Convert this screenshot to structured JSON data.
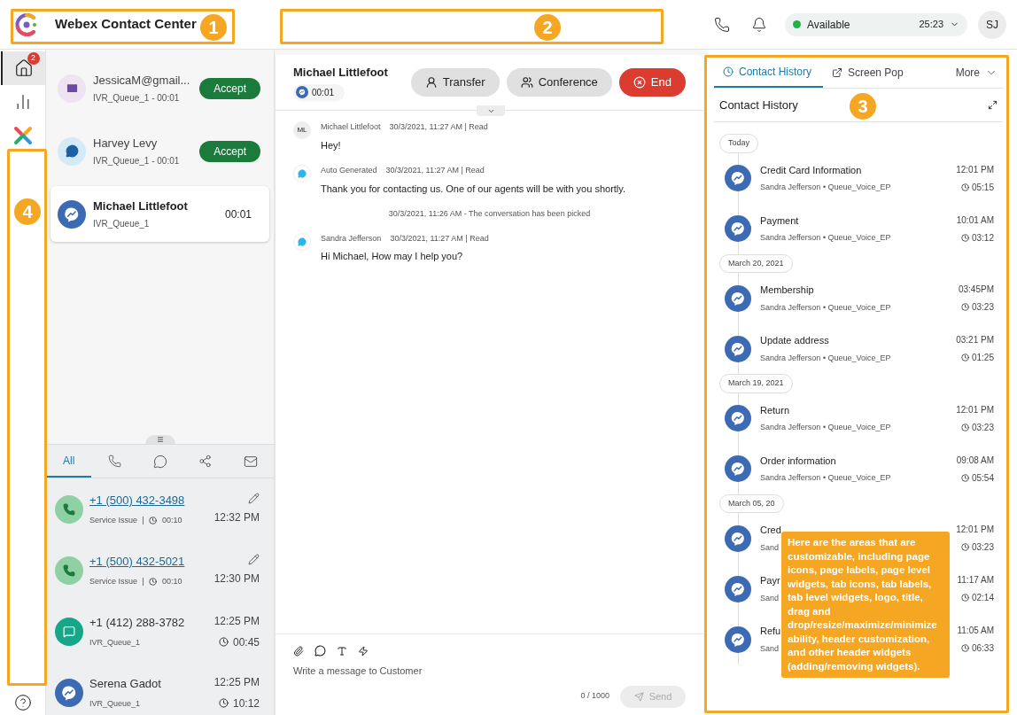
{
  "header": {
    "title": "Webex Contact Center",
    "status": {
      "label": "Available",
      "color": "#22b14c",
      "timer": "25:23"
    },
    "avatar": "SJ"
  },
  "nav": [
    {
      "kind": "home",
      "badge": "2",
      "selected": true
    },
    {
      "kind": "chart",
      "selected": false
    },
    {
      "kind": "apps",
      "selected": false
    }
  ],
  "tasks": [
    {
      "kind": "email",
      "name": "JessicaM@gmail...",
      "sub": "IVR_Queue_1 - 00:01",
      "action": "Accept",
      "selected": false
    },
    {
      "kind": "chat",
      "name": "Harvey Levy",
      "sub": "IVR_Queue_1 - 00:01",
      "action": "Accept",
      "selected": false
    },
    {
      "kind": "messenger",
      "name": "Michael Littlefoot",
      "sub": "IVR_Queue_1",
      "timer": "00:01",
      "selected": true
    }
  ],
  "history_tabs": [
    {
      "kind": "text",
      "label": "All",
      "selected": true
    },
    {
      "kind": "phone",
      "selected": false
    },
    {
      "kind": "chat",
      "selected": false
    },
    {
      "kind": "social",
      "selected": false
    },
    {
      "kind": "email",
      "selected": false
    }
  ],
  "history": [
    {
      "kind": "call",
      "title": "+1 (500) 432-3498",
      "link": true,
      "sub": "Service Issue",
      "duration": "00:10",
      "time": "12:32 PM"
    },
    {
      "kind": "call",
      "title": "+1 (500) 432-5021",
      "link": true,
      "sub": "Service Issue",
      "duration": "00:10",
      "time": "12:30 PM"
    },
    {
      "kind": "sms",
      "title": "+1 (412) 288-3782",
      "link": false,
      "sub": "IVR_Queue_1",
      "duration": "00:45",
      "time": "12:25 PM"
    },
    {
      "kind": "messenger",
      "title": "Serena Gadot",
      "link": false,
      "sub": "IVR_Queue_1",
      "duration": "10:12",
      "time": "12:25 PM"
    }
  ],
  "conversation": {
    "name": "Michael Littlefoot",
    "timer": "00:01",
    "buttons": [
      {
        "kind": "transfer",
        "label": "Transfer"
      },
      {
        "kind": "conference",
        "label": "Conference"
      },
      {
        "kind": "end",
        "label": "End"
      }
    ],
    "messages": [
      {
        "kind": "initials",
        "avatar": "ML",
        "sender": "Michael Littlefoot",
        "meta": "30/3/2021, 11:27 AM | Read",
        "text": "Hey!"
      },
      {
        "kind": "bot",
        "sender": "Auto Generated",
        "meta": "30/3/2021, 11:27 AM | Read",
        "text": "Thank you for contacting us. One of our agents will be with you shortly."
      },
      {
        "kind": "system",
        "text": "30/3/2021, 11:26 AM - The conversation has been picked"
      },
      {
        "kind": "bot",
        "sender": "Sandra Jefferson",
        "meta": "30/3/2021, 11:27 AM | Read",
        "text": "Hi Michael, How may I help you?"
      }
    ],
    "composer": {
      "placeholder": "Write a message to Customer",
      "count": "0 / 1000",
      "send": "Send",
      "disabled": true
    }
  },
  "side": {
    "tabs": [
      {
        "kind": "clock",
        "label": "Contact History",
        "selected": true
      },
      {
        "kind": "external",
        "label": "Screen Pop",
        "selected": false
      }
    ],
    "more": "More",
    "title": "Contact History",
    "groups": [
      {
        "date": "Today",
        "items": [
          {
            "title": "Credit Card Information",
            "sub": "Sandra Jefferson • Queue_Voice_EP",
            "time": "12:01 PM",
            "duration": "05:15"
          },
          {
            "title": "Payment",
            "sub": "Sandra Jefferson • Queue_Voice_EP",
            "time": "10:01 AM",
            "duration": "03:12"
          }
        ]
      },
      {
        "date": "March 20, 2021",
        "items": [
          {
            "title": "Membership",
            "sub": "Sandra Jefferson • Queue_Voice_EP",
            "time": "03:45PM",
            "duration": "03:23"
          },
          {
            "title": "Update address",
            "sub": "Sandra Jefferson • Queue_Voice_EP",
            "time": "03:21 PM",
            "duration": "01:25"
          }
        ]
      },
      {
        "date": "March 19, 2021",
        "items": [
          {
            "title": "Return",
            "sub": "Sandra Jefferson • Queue_Voice_EP",
            "time": "12:01 PM",
            "duration": "03:23"
          },
          {
            "title": "Order information",
            "sub": "Sandra Jefferson • Queue_Voice_EP",
            "time": "09:08 AM",
            "duration": "05:54"
          }
        ]
      },
      {
        "date": "March 05, 20",
        "items": [
          {
            "title": "Cred",
            "sub": "Sand",
            "time": "12:01 PM",
            "duration": "03:23"
          },
          {
            "title": "Payr",
            "sub": "Sand",
            "time": "11:17 AM",
            "duration": "02:14"
          },
          {
            "title": "Refu",
            "sub": "Sand",
            "time": "11:05 AM",
            "duration": "06:33"
          }
        ]
      }
    ]
  },
  "annotations": {
    "markers": [
      "1",
      "2",
      "3",
      "4"
    ],
    "callout": "Here are the areas that are customizable, including page icons, page labels, page level widgets, tab icons, tab labels, tab level widgets, logo, title, drag and drop/resize/maximize/minimize ability, header customization, and other header widgets (adding/removing widgets)."
  }
}
